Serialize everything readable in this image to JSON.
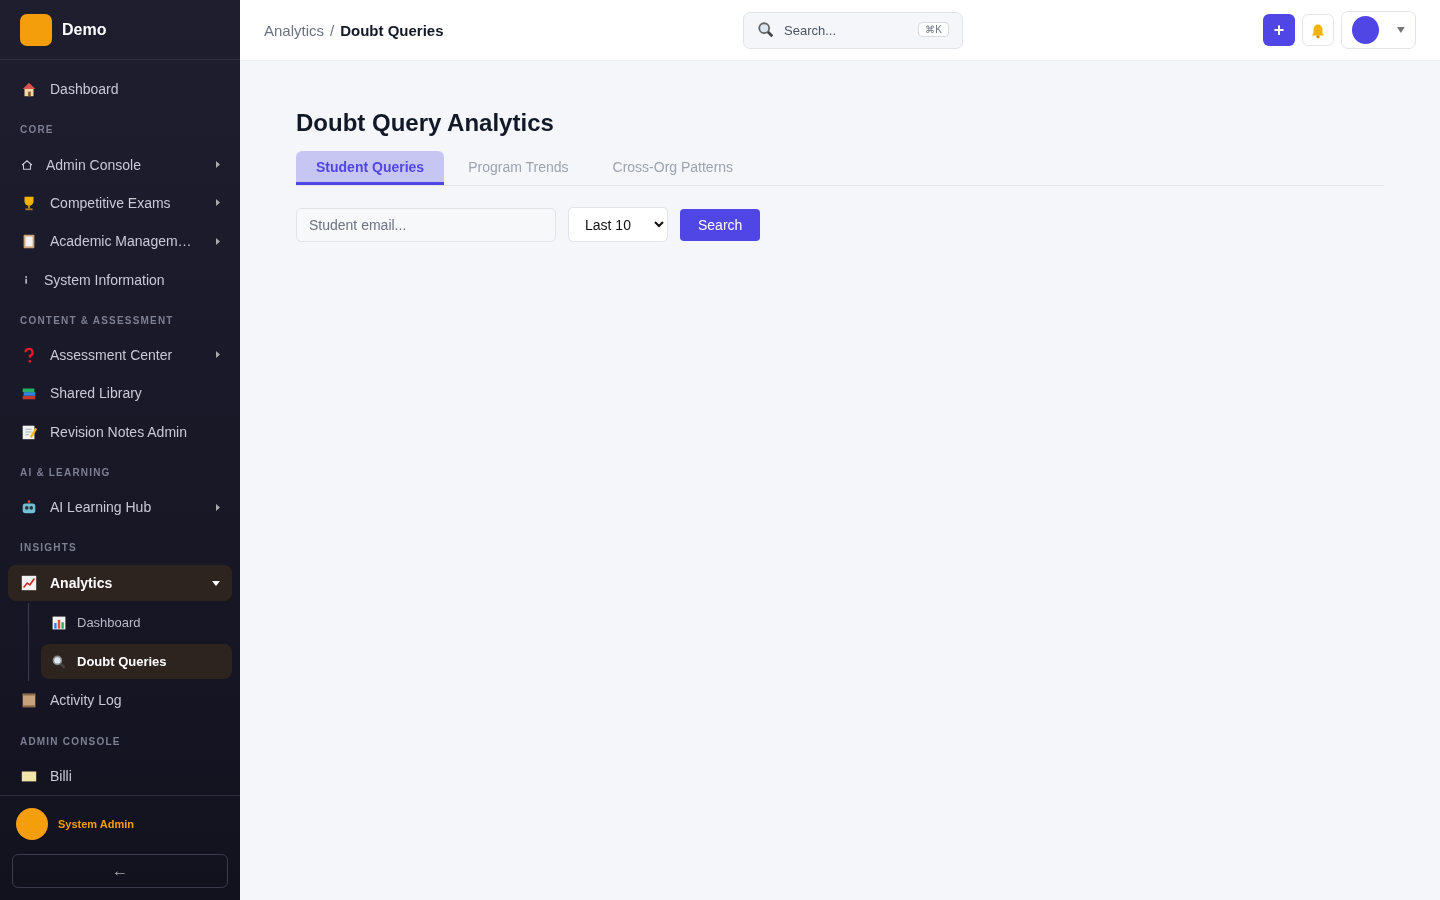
{
  "brand": {
    "name": "Demo"
  },
  "sidebar": {
    "items": [
      {
        "kind": "link",
        "label": "Dashboard",
        "selected": false
      },
      {
        "kind": "section",
        "label": "CORE"
      },
      {
        "kind": "link",
        "label": "Admin Console",
        "selected": false,
        "has_submenu": true
      },
      {
        "kind": "link",
        "label": "Competitive Exams",
        "selected": false,
        "has_submenu": true
      },
      {
        "kind": "link",
        "label": "Academic Managem…",
        "selected": false,
        "has_submenu": true
      },
      {
        "kind": "link",
        "label": "System Information",
        "selected": false
      },
      {
        "kind": "section",
        "label": "CONTENT & ASSESSMENT"
      },
      {
        "kind": "link",
        "label": "Assessment Center",
        "selected": false,
        "has_submenu": true
      },
      {
        "kind": "link",
        "label": "Shared Library",
        "selected": false
      },
      {
        "kind": "link",
        "label": "Revision Notes Admin",
        "selected": false
      },
      {
        "kind": "section",
        "label": "AI & LEARNING"
      },
      {
        "kind": "link",
        "label": "AI Learning Hub",
        "selected": false,
        "has_submenu": true
      },
      {
        "kind": "section",
        "label": "INSIGHTS"
      },
      {
        "kind": "group",
        "label": "Analytics",
        "selected": true,
        "expanded": true,
        "children": [
          {
            "label": "Dashboard",
            "selected": false
          },
          {
            "label": "Doubt Queries",
            "selected": true
          }
        ]
      },
      {
        "kind": "link",
        "label": "Activity Log",
        "selected": false
      },
      {
        "kind": "section",
        "label": "ADMIN CONSOLE"
      },
      {
        "kind": "link",
        "label": "Billi",
        "selected": false
      }
    ],
    "user": {
      "name": "System Admin"
    },
    "collapse_button": "←"
  },
  "breadcrumb": {
    "items": [
      "Analytics",
      "Doubt Queries"
    ],
    "separator": "/"
  },
  "topbar": {
    "search": {
      "placeholder": "Search...",
      "shortcut": "⌘K"
    },
    "add_button": "+"
  },
  "page": {
    "title": "Doubt Query Analytics",
    "tabs": [
      {
        "label": "Student Queries",
        "selected": true
      },
      {
        "label": "Program Trends",
        "selected": false
      },
      {
        "label": "Cross-Org Patterns",
        "selected": false
      }
    ],
    "email_field": {
      "placeholder": "Student email..."
    },
    "limit_select": {
      "value": "Last 10"
    },
    "search_button": "Search"
  }
}
